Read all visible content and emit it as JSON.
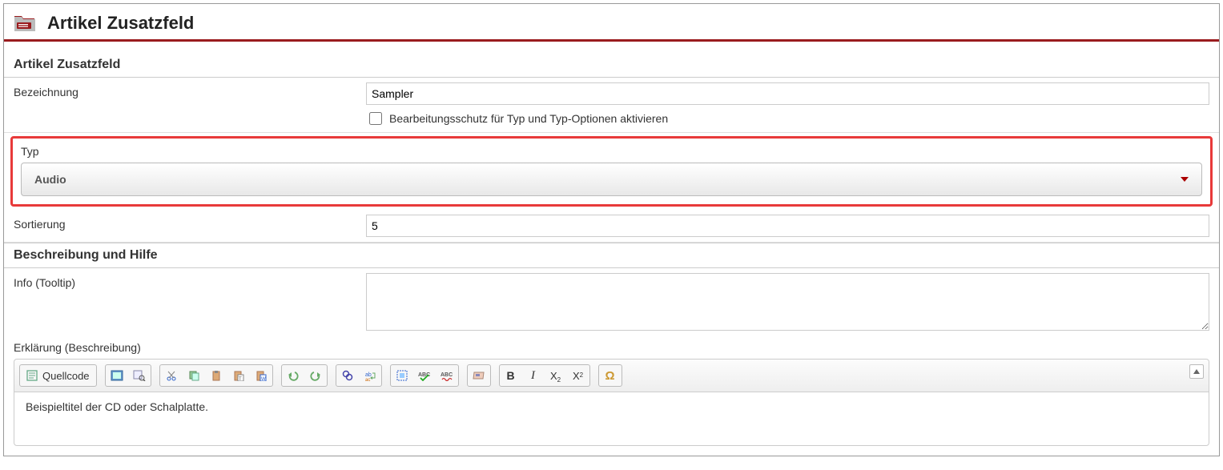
{
  "header": {
    "title": "Artikel Zusatzfeld"
  },
  "section1": {
    "title": "Artikel Zusatzfeld"
  },
  "form": {
    "bezeichnung_label": "Bezeichnung",
    "bezeichnung_value": "Sampler",
    "lock_checkbox_label": "Bearbeitungsschutz für Typ und Typ-Optionen aktivieren",
    "typ_label": "Typ",
    "typ_value": "Audio",
    "sort_label": "Sortierung",
    "sort_value": "5"
  },
  "section2": {
    "title": "Beschreibung und Hilfe"
  },
  "info": {
    "label": "Info (Tooltip)",
    "value": ""
  },
  "explain": {
    "label": "Erklärung (Beschreibung)"
  },
  "editor": {
    "quellcode": "Quellcode",
    "content": "Beispieltitel der CD oder Schalplatte."
  }
}
